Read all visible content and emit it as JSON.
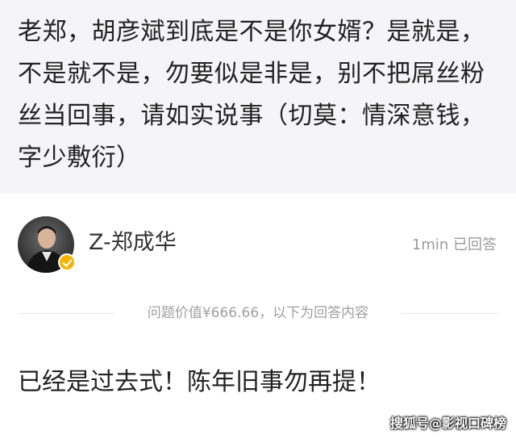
{
  "question": {
    "text": "老郑，胡彦斌到底是不是你女婿？是就是，不是就不是，勿要似是非是，别不把屌丝粉丝当回事，请如实说事（切莫：情深意钱，字少敷衍）"
  },
  "answer": {
    "username": "Z-郑成华",
    "time": "1min 已回答",
    "value_text": "问题价值¥666.66，以下为回答内容",
    "content": "已经是过去式！陈年旧事勿再提！"
  },
  "watermark": "搜狐号@影视口碑榜",
  "colors": {
    "question_bg": "#f5f5f7",
    "text": "#222222",
    "muted": "#9a9a9a",
    "badge": "#f5b400"
  }
}
